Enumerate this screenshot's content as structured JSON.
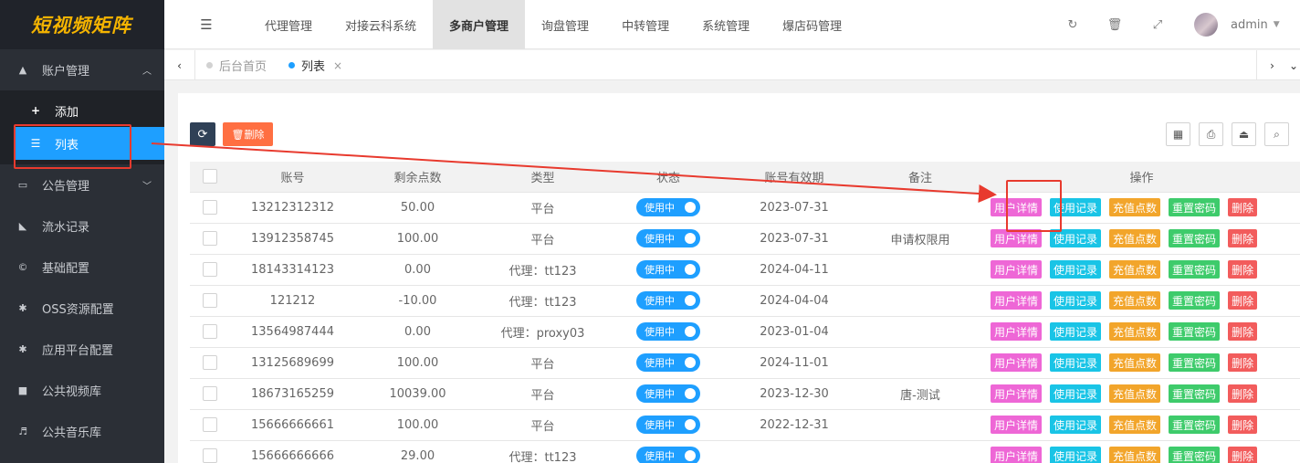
{
  "app": {
    "logo": "短视频矩阵"
  },
  "sidebar": {
    "items": [
      {
        "label": "账户管理",
        "icon": "user-icon",
        "glyph": "▲",
        "chevron": "︿"
      },
      {
        "label": "公告管理",
        "icon": "card-icon",
        "glyph": "▭",
        "chevron": "﹀"
      },
      {
        "label": "流水记录",
        "icon": "chart-icon",
        "glyph": "◣"
      },
      {
        "label": "基础配置",
        "icon": "cc-icon",
        "glyph": "©"
      },
      {
        "label": "OSS资源配置",
        "icon": "gear-icon",
        "glyph": "✱"
      },
      {
        "label": "应用平台配置",
        "icon": "gear-icon",
        "glyph": "✱"
      },
      {
        "label": "公共视频库",
        "icon": "video-icon",
        "glyph": "■"
      },
      {
        "label": "公共音乐库",
        "icon": "music-icon",
        "glyph": "♬"
      }
    ],
    "sub_items": [
      {
        "label": "添加",
        "icon": "plus-circle-icon",
        "glyph": "+"
      },
      {
        "label": "列表",
        "icon": "list-icon",
        "glyph": "☰"
      }
    ]
  },
  "header": {
    "menu_glyph": "☰",
    "nav": [
      "代理管理",
      "对接云科系统",
      "多商户管理",
      "询盘管理",
      "中转管理",
      "系统管理",
      "爆店码管理"
    ],
    "refresh_glyph": "↻",
    "trash_glyph": "🗑",
    "fullscreen_glyph": "⤢",
    "user": "admin",
    "caret": "▼"
  },
  "tabs": {
    "left_arrow": "‹",
    "right_arrow": "›",
    "more_arrow": "⌄",
    "items": [
      {
        "label": "后台首页"
      },
      {
        "label": "列表",
        "close": "×"
      }
    ]
  },
  "toolbar": {
    "refresh_glyph": "⟳",
    "delete_label": "🗑删除",
    "tool_glyphs": {
      "columns": "▦",
      "print": "⎙",
      "export": "⏏",
      "search": "⌕"
    }
  },
  "table": {
    "headers": [
      "账号",
      "剩余点数",
      "类型",
      "状态",
      "账号有效期",
      "备注",
      "操作"
    ],
    "status_label": "使用中",
    "actions": [
      "用户详情",
      "使用记录",
      "充值点数",
      "重置密码",
      "删除"
    ],
    "rows": [
      {
        "account": "13212312312",
        "points": "50.00",
        "type": "平台",
        "expiry": "2023-07-31",
        "note": ""
      },
      {
        "account": "13912358745",
        "points": "100.00",
        "type": "平台",
        "expiry": "2023-07-31",
        "note": "申请权限用"
      },
      {
        "account": "18143314123",
        "points": "0.00",
        "type": "代理：tt123",
        "expiry": "2024-04-11",
        "note": ""
      },
      {
        "account": "121212",
        "points": "-10.00",
        "type": "代理：tt123",
        "expiry": "2024-04-04",
        "note": ""
      },
      {
        "account": "13564987444",
        "points": "0.00",
        "type": "代理：proxy03",
        "expiry": "2023-01-04",
        "note": ""
      },
      {
        "account": "13125689699",
        "points": "100.00",
        "type": "平台",
        "expiry": "2024-11-01",
        "note": ""
      },
      {
        "account": "18673165259",
        "points": "10039.00",
        "type": "平台",
        "expiry": "2023-12-30",
        "note": "唐-测试"
      },
      {
        "account": "15666666661",
        "points": "100.00",
        "type": "平台",
        "expiry": "2022-12-31",
        "note": ""
      },
      {
        "account": "15666666666",
        "points": "29.00",
        "type": "代理：tt123",
        "expiry": "",
        "note": ""
      }
    ]
  },
  "colors": {
    "sidebar_bg": "#2b2f36",
    "active_blue": "#1e9fff",
    "logo_yellow": "#f5b400",
    "annotation_red": "#e83a2e"
  }
}
